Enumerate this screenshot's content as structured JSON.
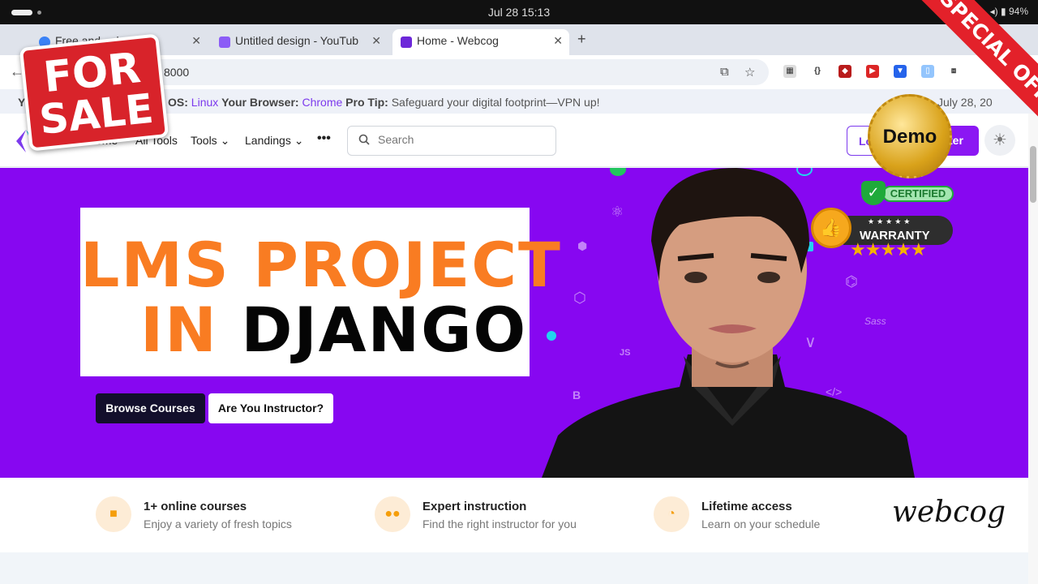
{
  "os": {
    "clock": "Jul 28  15:13",
    "battery": "94%"
  },
  "browser": {
    "tabs": [
      {
        "title": "Free and ... le Y"
      },
      {
        "title": "Untitled design - YouTub"
      },
      {
        "title": "Home - Webcog"
      }
    ],
    "new_tab": "+",
    "address": "8000"
  },
  "banner": {
    "lead": "Y",
    "os_label": "ur OS:",
    "os_value": "Linux",
    "browser_label": "Your Browser:",
    "browser_value": "Chrome",
    "tip_label": "Pro Tip:",
    "tip_text": "Safeguard your digital footprint—VPN up!",
    "date": "July 28, 20"
  },
  "nav": {
    "home": "ome",
    "all_tools": "All Tools",
    "tools": "Tools",
    "landings": "Landings",
    "more": "•••",
    "search_placeholder": "Search",
    "login": "Lo",
    "register": "ter"
  },
  "hero": {
    "line1": "LMS PROJECT",
    "line2_in": "IN",
    "line2_django": "DJANGO",
    "browse_button": "Browse Courses",
    "instructor_button": "Are You Instructor?"
  },
  "features": [
    {
      "icon": "video-icon",
      "title": "1+ online courses",
      "subtitle": "Enjoy a variety of fresh topics"
    },
    {
      "icon": "users-icon",
      "title": "Expert instruction",
      "subtitle": "Find the right instructor for you"
    },
    {
      "icon": "clock-icon",
      "title": "Lifetime access",
      "subtitle": "Learn on your schedule"
    }
  ],
  "signature": "webcog",
  "overlays": {
    "for_sale_1": "FOR",
    "for_sale_2": "SALE",
    "special_offer": "SPECIAL OFFER",
    "demo": "Demo",
    "certified": "CERTIFIED",
    "warranty": "WARRANTY"
  },
  "colors": {
    "hero_bg": "#8707f1",
    "accent_orange": "#f97c22",
    "brand_purple": "#8b17f3"
  }
}
